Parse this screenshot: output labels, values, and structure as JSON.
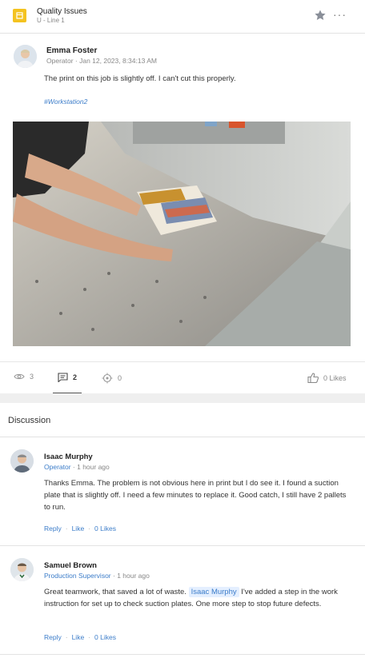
{
  "channel": {
    "title": "Quality Issues",
    "subtitle": "U - Line 1",
    "icon": "box-icon"
  },
  "post": {
    "author": "Emma Foster",
    "meta": "Operator · Jan 12, 2023, 8:34:13 AM",
    "text": "The print on this job is slightly off. I can't cut this properly.",
    "tag": "#Workstation2"
  },
  "stats": {
    "views": "3",
    "comments": "2",
    "follows": "0",
    "likes": "0 Likes"
  },
  "discussion": {
    "title": "Discussion",
    "comments": [
      {
        "author": "Isaac Murphy",
        "role": "Operator",
        "time": " · 1 hour ago",
        "body": "Thanks Emma. The problem is not obvious here in print but I do see it. I found a suction plate that is slightly off. I need a few minutes to replace it. Good catch, I still have 2 pallets to run.",
        "reply": "Reply",
        "like": "Like",
        "likes": "0 Likes"
      },
      {
        "author": "Samuel Brown",
        "role": "Production Supervisor",
        "time": " · 1 hour ago",
        "body_pre": "Great teamwork, that saved a lot of waste. ",
        "mention": "Isaac Murphy",
        "body_post": " I've added a step in the work instruction for set up to check suction plates. One more step to stop future defects.",
        "reply": "Reply",
        "like": "Like",
        "likes": "0 Likes"
      }
    ]
  },
  "colors": {
    "accent": "#3b7cc9",
    "channel_icon": "#f4c320"
  }
}
